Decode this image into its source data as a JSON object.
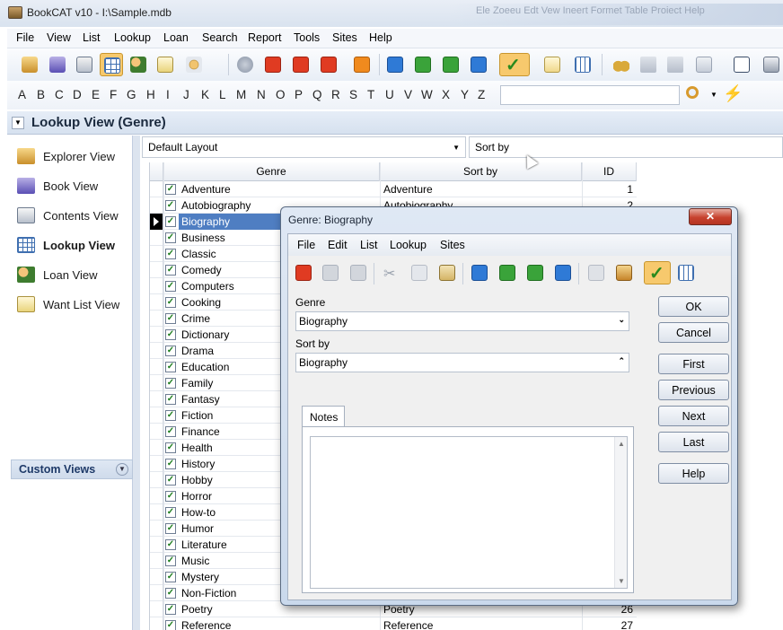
{
  "window": {
    "title": "BookCAT v10 - I:\\Sample.mdb",
    "ghost_menu": "Ele   Zoeeu   Edt   Vew   Ineert   Formet   Table   Proiect   Help"
  },
  "menu": [
    "File",
    "View",
    "List",
    "Lookup",
    "Loan",
    "Search",
    "Report",
    "Tools",
    "Sites",
    "Help"
  ],
  "alphabet": [
    "A",
    "B",
    "C",
    "D",
    "E",
    "F",
    "G",
    "H",
    "I",
    "J",
    "K",
    "L",
    "M",
    "N",
    "O",
    "P",
    "Q",
    "R",
    "S",
    "T",
    "U",
    "V",
    "W",
    "X",
    "Y",
    "Z"
  ],
  "search": {
    "value": ""
  },
  "view_header": {
    "title": "Lookup View (Genre)"
  },
  "views": [
    {
      "label": "Explorer View",
      "icon": "explorer-view-icon"
    },
    {
      "label": "Book View",
      "icon": "book-view-icon"
    },
    {
      "label": "Contents View",
      "icon": "contents-view-icon"
    },
    {
      "label": "Lookup View",
      "icon": "lookup-view-icon",
      "active": true
    },
    {
      "label": "Loan View",
      "icon": "loan-view-icon"
    },
    {
      "label": "Want List View",
      "icon": "want-list-view-icon"
    }
  ],
  "custom_views": {
    "label": "Custom Views"
  },
  "layout_select": {
    "value": "Default Layout"
  },
  "sort_select": {
    "value": "Sort by"
  },
  "grid": {
    "columns": [
      "Genre",
      "Sort by",
      "ID"
    ],
    "rows": [
      {
        "genre": "Adventure",
        "sort": "Adventure",
        "id": "1"
      },
      {
        "genre": "Autobiography",
        "sort": "Autobiography",
        "id": "2"
      },
      {
        "genre": "Biography",
        "sort": "",
        "id": "",
        "selected": true
      },
      {
        "genre": "Business",
        "sort": "",
        "id": ""
      },
      {
        "genre": "Classic",
        "sort": "",
        "id": ""
      },
      {
        "genre": "Comedy",
        "sort": "",
        "id": ""
      },
      {
        "genre": "Computers",
        "sort": "",
        "id": ""
      },
      {
        "genre": "Cooking",
        "sort": "",
        "id": ""
      },
      {
        "genre": "Crime",
        "sort": "",
        "id": ""
      },
      {
        "genre": "Dictionary",
        "sort": "",
        "id": ""
      },
      {
        "genre": "Drama",
        "sort": "",
        "id": ""
      },
      {
        "genre": "Education",
        "sort": "",
        "id": ""
      },
      {
        "genre": "Family",
        "sort": "",
        "id": ""
      },
      {
        "genre": "Fantasy",
        "sort": "",
        "id": ""
      },
      {
        "genre": "Fiction",
        "sort": "",
        "id": ""
      },
      {
        "genre": "Finance",
        "sort": "",
        "id": ""
      },
      {
        "genre": "Health",
        "sort": "",
        "id": ""
      },
      {
        "genre": "History",
        "sort": "",
        "id": ""
      },
      {
        "genre": "Hobby",
        "sort": "",
        "id": ""
      },
      {
        "genre": "Horror",
        "sort": "",
        "id": ""
      },
      {
        "genre": "How-to",
        "sort": "",
        "id": ""
      },
      {
        "genre": "Humor",
        "sort": "",
        "id": ""
      },
      {
        "genre": "Literature",
        "sort": "",
        "id": ""
      },
      {
        "genre": "Music",
        "sort": "",
        "id": ""
      },
      {
        "genre": "Mystery",
        "sort": "",
        "id": ""
      },
      {
        "genre": "Non-Fiction",
        "sort": "",
        "id": ""
      },
      {
        "genre": "Poetry",
        "sort": "Poetry",
        "id": "26"
      },
      {
        "genre": "Reference",
        "sort": "Reference",
        "id": "27"
      }
    ]
  },
  "dialog": {
    "title": "Genre: Biography",
    "close_label": "✕",
    "menu": [
      "File",
      "Edit",
      "List",
      "Lookup",
      "Sites"
    ],
    "genre_label": "Genre",
    "genre_value": "Biography",
    "sortby_label": "Sort by",
    "sortby_value": "Biography",
    "notes_tab": "Notes",
    "notes_value": "",
    "buttons": {
      "ok": "OK",
      "cancel": "Cancel",
      "first": "First",
      "previous": "Previous",
      "next": "Next",
      "last": "Last",
      "help": "Help"
    }
  },
  "colors": {
    "selection": "#4f7ec2",
    "accent_active": "#f7c96d",
    "close": "#c7422e"
  }
}
